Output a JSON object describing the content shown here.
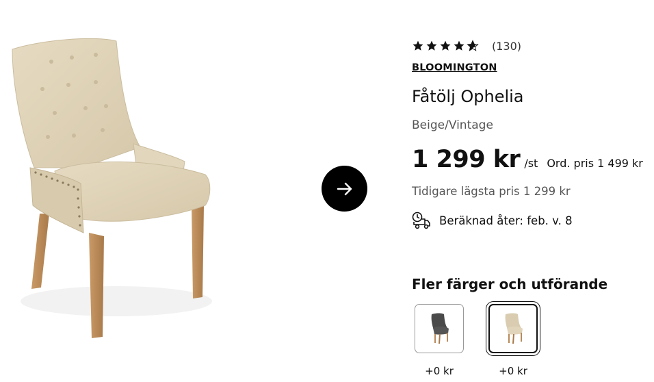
{
  "product": {
    "rating_stars": 4.5,
    "rating_count": "(130)",
    "brand": "BLOOMINGTON",
    "title": "Fåtölj Ophelia",
    "variant": "Beige/Vintage",
    "price": "1 299 kr",
    "unit": "/st",
    "ordinary_price": "Ord. pris 1 499 kr",
    "previous_lowest": "Tidigare lägsta pris 1 299 kr",
    "delivery": "Beräknad åter: feb. v. 8"
  },
  "variants_section": {
    "title": "Fler färger och utförande",
    "items": [
      {
        "price": "+0 kr",
        "color": "#4a4a4a",
        "selected": false
      },
      {
        "price": "+0 kr",
        "color": "#d9ccb0",
        "selected": true
      }
    ]
  },
  "colors": {
    "fabric": "#ddd0b4",
    "wood": "#b88a5a",
    "button_bg": "#000000"
  },
  "icons": {
    "next": "arrow-right-icon",
    "delivery": "delivery-truck-clock-icon"
  }
}
